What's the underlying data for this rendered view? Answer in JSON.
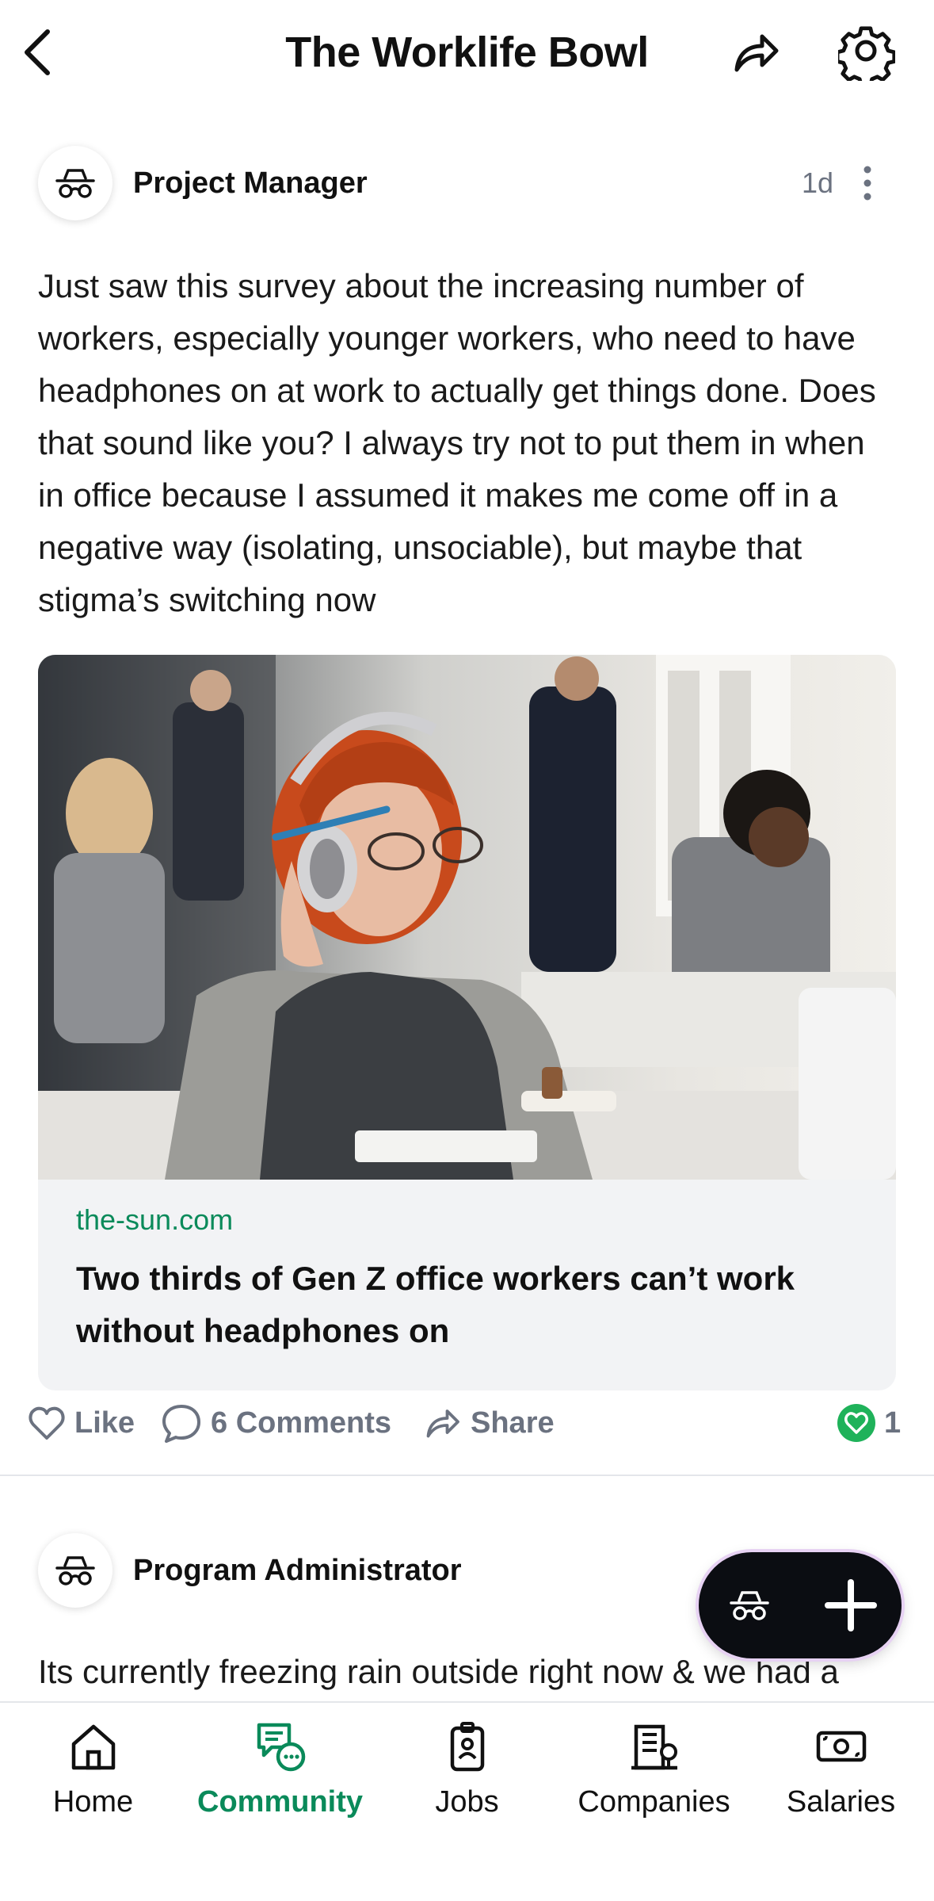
{
  "header": {
    "title": "The Worklife Bowl",
    "back_icon": "chevron-left-icon",
    "share_icon": "share-arrow-icon",
    "settings_icon": "gear-icon"
  },
  "post": {
    "author": "Project Manager",
    "time": "1d",
    "avatar_icon": "incognito-icon",
    "menu_icon": "more-vertical-icon",
    "body": "Just saw this survey about the increasing number of workers, especially younger workers, who need to have headphones on at work to actually get things done. Does that sound like you? I always try not to put them in when in office because I assumed it makes me come off in a negative way (isolating, unsociable), but maybe that stigma’s switching now",
    "link": {
      "domain": "the-sun.com",
      "headline": "Two thirds of Gen Z office workers can’t work without headphones on"
    },
    "actions": {
      "like": "Like",
      "comments": "6 Comments",
      "share": "Share",
      "reaction_count": "1"
    }
  },
  "next_post": {
    "author": "Program Administrator",
    "body_preview": "Its currently freezing rain outside right now & we had a"
  },
  "fab": {
    "left_icon": "incognito-icon",
    "right_icon": "plus-icon"
  },
  "tabs": [
    {
      "label": "Home",
      "icon": "home-icon"
    },
    {
      "label": "Community",
      "icon": "community-chat-icon",
      "active": true
    },
    {
      "label": "Jobs",
      "icon": "badge-icon"
    },
    {
      "label": "Companies",
      "icon": "building-icon"
    },
    {
      "label": "Salaries",
      "icon": "cash-icon"
    }
  ],
  "colors": {
    "accent": "#0a8a5a",
    "muted": "#6b7280",
    "reaction_green": "#1fb25a",
    "fab_bg": "#0b0d12"
  }
}
